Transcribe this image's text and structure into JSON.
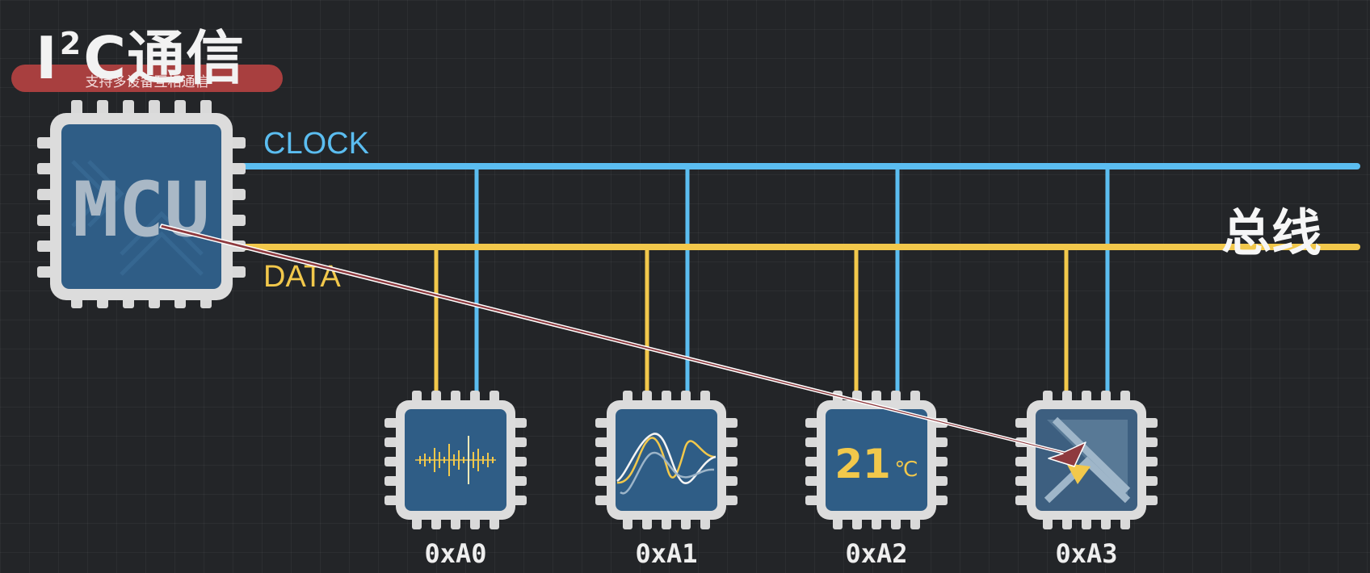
{
  "title": {
    "prefix": "I",
    "superscript": "2",
    "suffix": "C通信"
  },
  "subtitle": "支持多设备互相通信",
  "bus_label": "总线",
  "lines": {
    "clock": {
      "label": "CLOCK",
      "color": "#5bbdf0"
    },
    "data": {
      "label": "DATA",
      "color": "#f2c84b"
    }
  },
  "master": {
    "label": "MCU"
  },
  "devices": [
    {
      "address": "0xA0",
      "icon": "audio-waveform-icon"
    },
    {
      "address": "0xA1",
      "icon": "signal-curves-icon"
    },
    {
      "address": "0xA2",
      "icon": "temperature-icon",
      "value": "21",
      "unit": "℃"
    },
    {
      "address": "0xA3",
      "icon": "direction-arrow-icon"
    }
  ],
  "colors": {
    "chip_body": "#2f5d86",
    "chip_frame": "#dcdcdc",
    "arrow": "#8e3a3f"
  }
}
